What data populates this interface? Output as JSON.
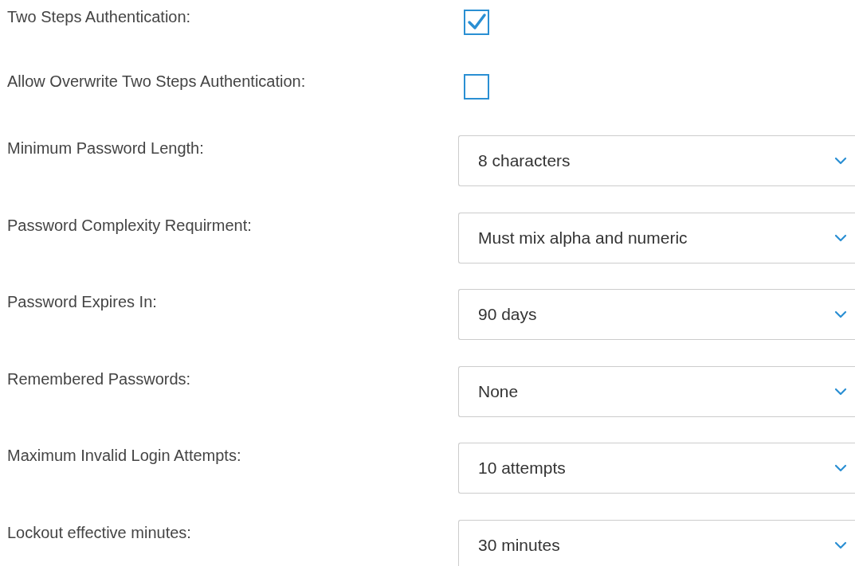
{
  "settings": [
    {
      "kind": "checkbox",
      "label": "Two Steps Authentication:",
      "checked": true
    },
    {
      "kind": "checkbox",
      "label": "Allow Overwrite Two Steps Authentication:",
      "checked": false
    },
    {
      "kind": "select",
      "label": "Minimum Password Length:",
      "value": "8 characters"
    },
    {
      "kind": "select",
      "label": "Password Complexity Requirment:",
      "value": "Must mix alpha and numeric"
    },
    {
      "kind": "select",
      "label": "Password Expires In:",
      "value": "90 days"
    },
    {
      "kind": "select",
      "label": "Remembered Passwords:",
      "value": "None"
    },
    {
      "kind": "select",
      "label": "Maximum Invalid Login Attempts:",
      "value": "10 attempts"
    },
    {
      "kind": "select",
      "label": "Lockout effective minutes:",
      "value": "30 minutes"
    }
  ]
}
